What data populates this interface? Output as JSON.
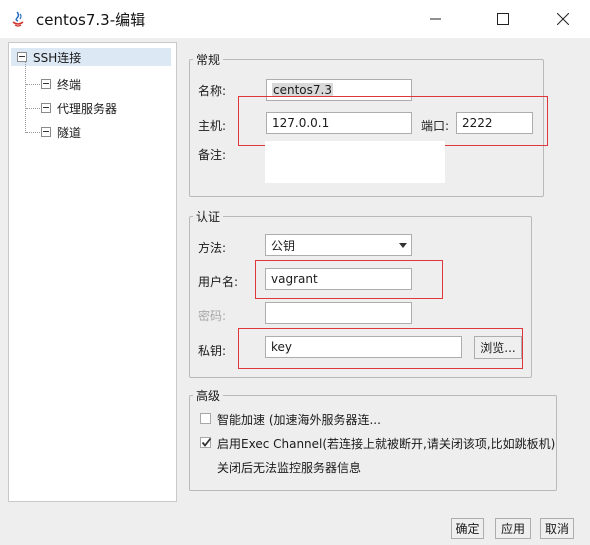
{
  "window": {
    "title": "centos7.3-编辑",
    "minimize_icon": "minimize-icon",
    "maximize_icon": "maximize-icon",
    "close_icon": "close-icon"
  },
  "tree": {
    "items": [
      {
        "label": "SSH连接",
        "level": 0
      },
      {
        "label": "终端",
        "level": 1
      },
      {
        "label": "代理服务器",
        "level": 1
      },
      {
        "label": "隧道",
        "level": 1
      }
    ]
  },
  "general": {
    "title": "常规",
    "name_label": "名称:",
    "name_value": "centos7.3",
    "host_label": "主机:",
    "host_value": "127.0.0.1",
    "port_label": "端口:",
    "port_value": "2222",
    "note_label": "备注:",
    "note_value": ""
  },
  "auth": {
    "title": "认证",
    "method_label": "方法:",
    "method_value": "公钥",
    "username_label": "用户名:",
    "username_value": "vagrant",
    "password_label": "密码:",
    "password_value": "",
    "key_label": "私钥:",
    "key_value": "key",
    "browse_label": "浏览..."
  },
  "advanced": {
    "title": "高级",
    "smart_accel_label": "智能加速 (加速海外服务器连...",
    "smart_accel_checked": false,
    "exec_channel_label": "启用Exec Channel(若连接上就被断开,请关闭该项,比如跳板机)",
    "exec_channel_checked": true,
    "exec_channel_note": "关闭后无法监控服务器信息"
  },
  "footer": {
    "ok_label": "确定",
    "apply_label": "应用",
    "cancel_label": "取消"
  },
  "colors": {
    "highlight_border": "#e0373d",
    "dialog_bg": "#eeeeee",
    "checkmark": "#333333"
  }
}
